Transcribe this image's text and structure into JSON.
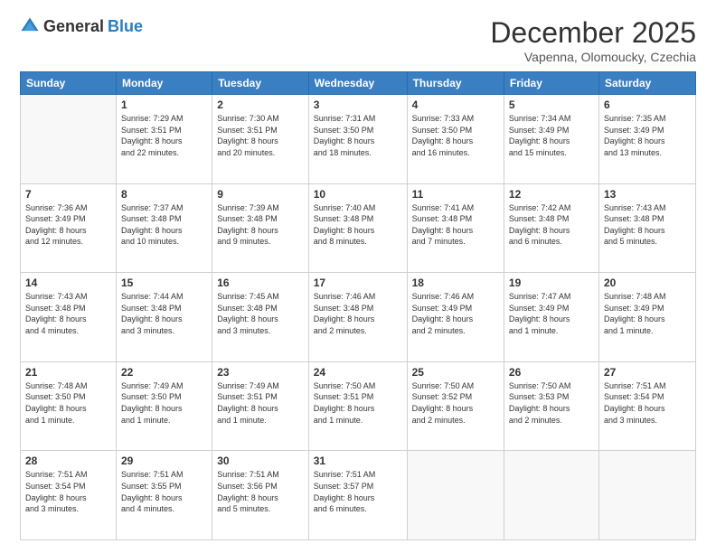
{
  "logo": {
    "general": "General",
    "blue": "Blue"
  },
  "title": "December 2025",
  "subtitle": "Vapenna, Olomoucky, Czechia",
  "days_of_week": [
    "Sunday",
    "Monday",
    "Tuesday",
    "Wednesday",
    "Thursday",
    "Friday",
    "Saturday"
  ],
  "weeks": [
    [
      {
        "day": "",
        "info": ""
      },
      {
        "day": "1",
        "info": "Sunrise: 7:29 AM\nSunset: 3:51 PM\nDaylight: 8 hours\nand 22 minutes."
      },
      {
        "day": "2",
        "info": "Sunrise: 7:30 AM\nSunset: 3:51 PM\nDaylight: 8 hours\nand 20 minutes."
      },
      {
        "day": "3",
        "info": "Sunrise: 7:31 AM\nSunset: 3:50 PM\nDaylight: 8 hours\nand 18 minutes."
      },
      {
        "day": "4",
        "info": "Sunrise: 7:33 AM\nSunset: 3:50 PM\nDaylight: 8 hours\nand 16 minutes."
      },
      {
        "day": "5",
        "info": "Sunrise: 7:34 AM\nSunset: 3:49 PM\nDaylight: 8 hours\nand 15 minutes."
      },
      {
        "day": "6",
        "info": "Sunrise: 7:35 AM\nSunset: 3:49 PM\nDaylight: 8 hours\nand 13 minutes."
      }
    ],
    [
      {
        "day": "7",
        "info": "Sunrise: 7:36 AM\nSunset: 3:49 PM\nDaylight: 8 hours\nand 12 minutes."
      },
      {
        "day": "8",
        "info": "Sunrise: 7:37 AM\nSunset: 3:48 PM\nDaylight: 8 hours\nand 10 minutes."
      },
      {
        "day": "9",
        "info": "Sunrise: 7:39 AM\nSunset: 3:48 PM\nDaylight: 8 hours\nand 9 minutes."
      },
      {
        "day": "10",
        "info": "Sunrise: 7:40 AM\nSunset: 3:48 PM\nDaylight: 8 hours\nand 8 minutes."
      },
      {
        "day": "11",
        "info": "Sunrise: 7:41 AM\nSunset: 3:48 PM\nDaylight: 8 hours\nand 7 minutes."
      },
      {
        "day": "12",
        "info": "Sunrise: 7:42 AM\nSunset: 3:48 PM\nDaylight: 8 hours\nand 6 minutes."
      },
      {
        "day": "13",
        "info": "Sunrise: 7:43 AM\nSunset: 3:48 PM\nDaylight: 8 hours\nand 5 minutes."
      }
    ],
    [
      {
        "day": "14",
        "info": "Sunrise: 7:43 AM\nSunset: 3:48 PM\nDaylight: 8 hours\nand 4 minutes."
      },
      {
        "day": "15",
        "info": "Sunrise: 7:44 AM\nSunset: 3:48 PM\nDaylight: 8 hours\nand 3 minutes."
      },
      {
        "day": "16",
        "info": "Sunrise: 7:45 AM\nSunset: 3:48 PM\nDaylight: 8 hours\nand 3 minutes."
      },
      {
        "day": "17",
        "info": "Sunrise: 7:46 AM\nSunset: 3:48 PM\nDaylight: 8 hours\nand 2 minutes."
      },
      {
        "day": "18",
        "info": "Sunrise: 7:46 AM\nSunset: 3:49 PM\nDaylight: 8 hours\nand 2 minutes."
      },
      {
        "day": "19",
        "info": "Sunrise: 7:47 AM\nSunset: 3:49 PM\nDaylight: 8 hours\nand 1 minute."
      },
      {
        "day": "20",
        "info": "Sunrise: 7:48 AM\nSunset: 3:49 PM\nDaylight: 8 hours\nand 1 minute."
      }
    ],
    [
      {
        "day": "21",
        "info": "Sunrise: 7:48 AM\nSunset: 3:50 PM\nDaylight: 8 hours\nand 1 minute."
      },
      {
        "day": "22",
        "info": "Sunrise: 7:49 AM\nSunset: 3:50 PM\nDaylight: 8 hours\nand 1 minute."
      },
      {
        "day": "23",
        "info": "Sunrise: 7:49 AM\nSunset: 3:51 PM\nDaylight: 8 hours\nand 1 minute."
      },
      {
        "day": "24",
        "info": "Sunrise: 7:50 AM\nSunset: 3:51 PM\nDaylight: 8 hours\nand 1 minute."
      },
      {
        "day": "25",
        "info": "Sunrise: 7:50 AM\nSunset: 3:52 PM\nDaylight: 8 hours\nand 2 minutes."
      },
      {
        "day": "26",
        "info": "Sunrise: 7:50 AM\nSunset: 3:53 PM\nDaylight: 8 hours\nand 2 minutes."
      },
      {
        "day": "27",
        "info": "Sunrise: 7:51 AM\nSunset: 3:54 PM\nDaylight: 8 hours\nand 3 minutes."
      }
    ],
    [
      {
        "day": "28",
        "info": "Sunrise: 7:51 AM\nSunset: 3:54 PM\nDaylight: 8 hours\nand 3 minutes."
      },
      {
        "day": "29",
        "info": "Sunrise: 7:51 AM\nSunset: 3:55 PM\nDaylight: 8 hours\nand 4 minutes."
      },
      {
        "day": "30",
        "info": "Sunrise: 7:51 AM\nSunset: 3:56 PM\nDaylight: 8 hours\nand 5 minutes."
      },
      {
        "day": "31",
        "info": "Sunrise: 7:51 AM\nSunset: 3:57 PM\nDaylight: 8 hours\nand 6 minutes."
      },
      {
        "day": "",
        "info": ""
      },
      {
        "day": "",
        "info": ""
      },
      {
        "day": "",
        "info": ""
      }
    ]
  ]
}
